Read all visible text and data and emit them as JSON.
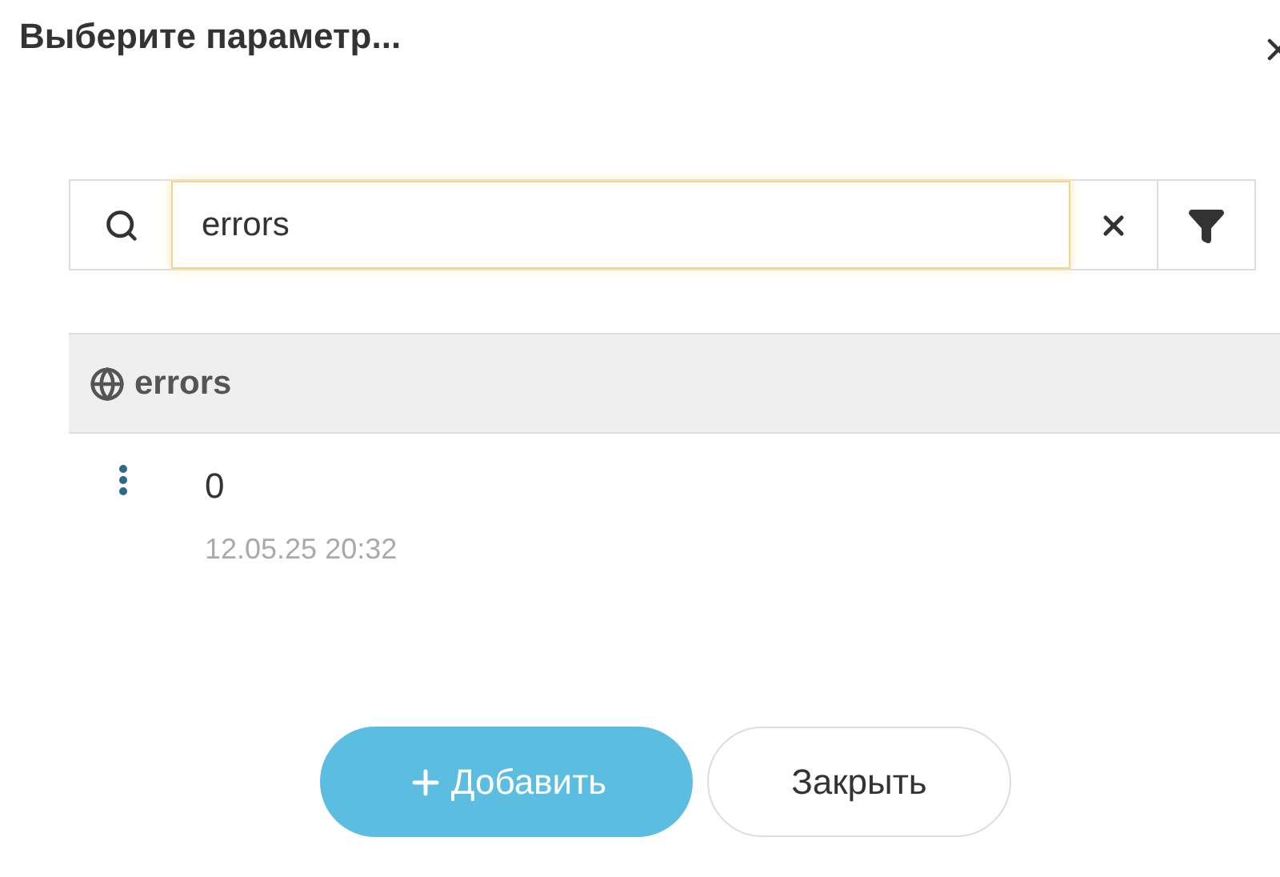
{
  "dialog": {
    "title": "Выберите параметр..."
  },
  "search": {
    "value": "errors"
  },
  "group": {
    "name": "errors"
  },
  "items": [
    {
      "value": "0",
      "time": "12.05.25 20:32"
    }
  ],
  "buttons": [
    {
      "kind": "primary",
      "label": "Добавить"
    },
    {
      "kind": "secondary",
      "label": "Закрыть"
    }
  ]
}
